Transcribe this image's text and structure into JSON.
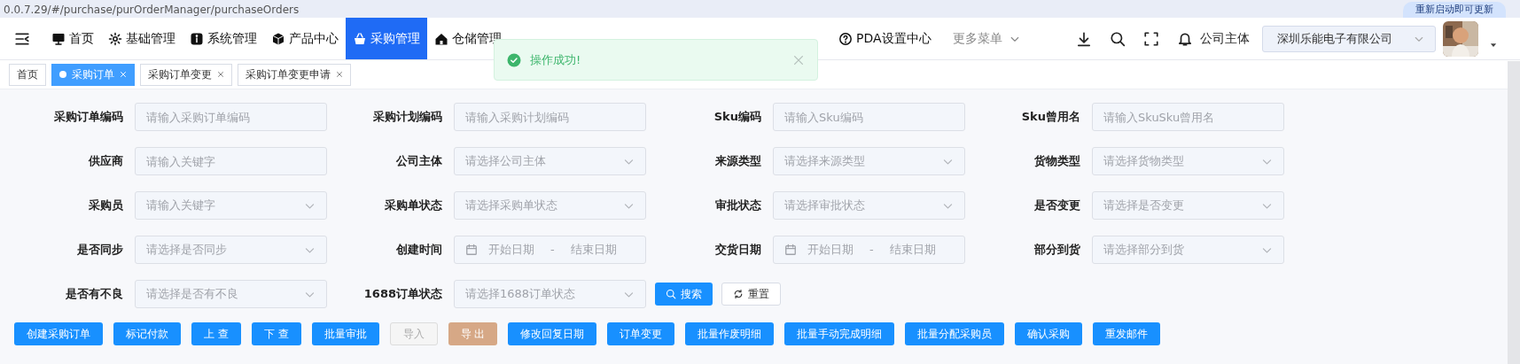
{
  "browser": {
    "url": "0.0.7.29/#/purchase/purOrderManager/purchaseOrders",
    "update_button": "重新启动即可更新"
  },
  "nav": {
    "items": [
      {
        "label": "首页",
        "selected": false
      },
      {
        "label": "基础管理",
        "selected": false
      },
      {
        "label": "系统管理",
        "selected": false
      },
      {
        "label": "产品中心",
        "selected": false
      },
      {
        "label": "采购管理",
        "selected": true
      },
      {
        "label": "仓储管理",
        "selected": false
      },
      {
        "label": "PDA设置中心",
        "selected": false
      }
    ],
    "more_menu": "更多菜单",
    "company_label": "公司主体",
    "company_value": "深圳乐能电子有限公司"
  },
  "toast": {
    "message": "操作成功!"
  },
  "tabs": [
    {
      "label": "首页",
      "selected": false,
      "closable": false
    },
    {
      "label": "采购订单",
      "selected": true,
      "closable": true
    },
    {
      "label": "采购订单变更",
      "selected": false,
      "closable": true
    },
    {
      "label": "采购订单变更申请",
      "selected": false,
      "closable": true
    }
  ],
  "filters": [
    {
      "label": "采购订单编码",
      "kind": "input",
      "placeholder": "请输入采购订单编码"
    },
    {
      "label": "采购计划编码",
      "kind": "input",
      "placeholder": "请输入采购计划编码"
    },
    {
      "label": "Sku编码",
      "kind": "input",
      "placeholder": "请输入Sku编码"
    },
    {
      "label": "Sku曾用名",
      "kind": "input",
      "placeholder": "请输入SkuSku曾用名"
    },
    {
      "label": "供应商",
      "kind": "input",
      "placeholder": "请输入关键字"
    },
    {
      "label": "公司主体",
      "kind": "select",
      "placeholder": "请选择公司主体"
    },
    {
      "label": "来源类型",
      "kind": "select",
      "placeholder": "请选择来源类型"
    },
    {
      "label": "货物类型",
      "kind": "select",
      "placeholder": "请选择货物类型"
    },
    {
      "label": "采购员",
      "kind": "select",
      "placeholder": "请输入关键字"
    },
    {
      "label": "采购单状态",
      "kind": "select",
      "placeholder": "请选择采购单状态"
    },
    {
      "label": "审批状态",
      "kind": "select",
      "placeholder": "请选择审批状态"
    },
    {
      "label": "是否变更",
      "kind": "select",
      "placeholder": "请选择是否变更"
    },
    {
      "label": "是否同步",
      "kind": "select",
      "placeholder": "请选择是否同步"
    },
    {
      "label": "创建时间",
      "kind": "daterange",
      "start": "开始日期",
      "separator": "-",
      "end": "结束日期"
    },
    {
      "label": "交货日期",
      "kind": "daterange",
      "start": "开始日期",
      "separator": "-",
      "end": "结束日期"
    },
    {
      "label": "部分到货",
      "kind": "select",
      "placeholder": "请选择部分到货"
    },
    {
      "label": "是否有不良",
      "kind": "select",
      "placeholder": "请选择是否有不良"
    },
    {
      "label": "1688订单状态",
      "kind": "select",
      "placeholder": "请选择1688订单状态"
    }
  ],
  "search_button": "搜索",
  "reset_button": "重置",
  "toolbar": [
    {
      "label": "创建采购订单",
      "kind": "primary"
    },
    {
      "label": "标记付款",
      "kind": "primary"
    },
    {
      "label": "上 查",
      "kind": "primary"
    },
    {
      "label": "下 查",
      "kind": "primary"
    },
    {
      "label": "批量审批",
      "kind": "primary"
    },
    {
      "label": "导入",
      "kind": "disabled"
    },
    {
      "label": "导 出",
      "kind": "export"
    },
    {
      "label": "修改回复日期",
      "kind": "primary"
    },
    {
      "label": "订单变更",
      "kind": "primary"
    },
    {
      "label": "批量作废明细",
      "kind": "primary"
    },
    {
      "label": "批量手动完成明细",
      "kind": "primary"
    },
    {
      "label": "批量分配采购员",
      "kind": "primary"
    },
    {
      "label": "确认采购",
      "kind": "primary"
    },
    {
      "label": "重发邮件",
      "kind": "primary"
    }
  ]
}
